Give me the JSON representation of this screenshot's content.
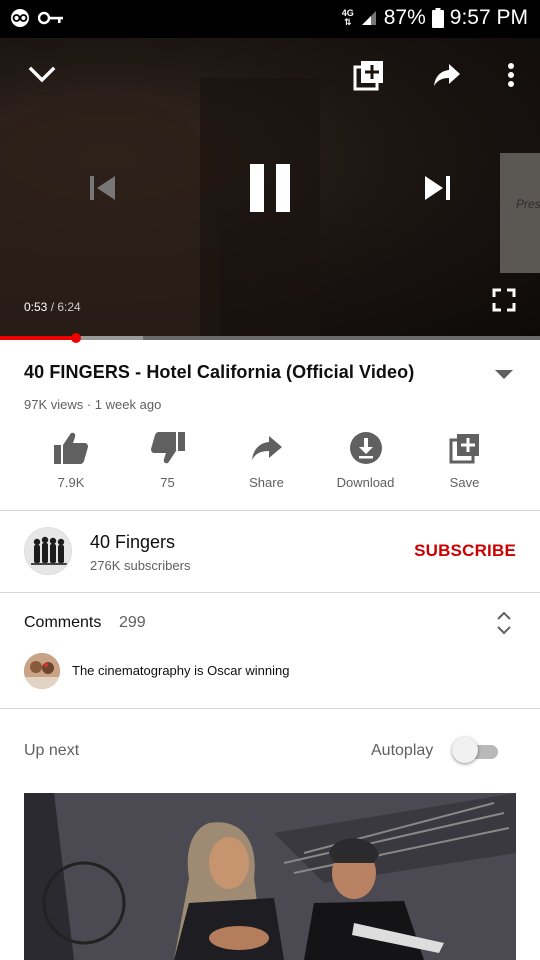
{
  "status_bar": {
    "network": "4G",
    "battery": "87%",
    "time": "9:57 PM"
  },
  "player": {
    "current_time": "0:53",
    "separator": " / ",
    "duration": "6:24",
    "progress_fraction": 0.14,
    "buffer_fraction": 0.265,
    "sign_text": "Pres"
  },
  "video": {
    "title": "40 FINGERS - Hotel California (Official Video)",
    "meta": "97K views · 1 week ago"
  },
  "actions": [
    {
      "label": "7.9K",
      "icon": "thumbs-up-icon"
    },
    {
      "label": "75",
      "icon": "thumbs-down-icon"
    },
    {
      "label": "Share",
      "icon": "share-icon"
    },
    {
      "label": "Download",
      "icon": "download-icon"
    },
    {
      "label": "Save",
      "icon": "add-to-playlist-icon"
    }
  ],
  "channel": {
    "name": "40 Fingers",
    "subscribers": "276K subscribers",
    "subscribe_label": "SUBSCRIBE"
  },
  "comments": {
    "title": "Comments",
    "count": "299",
    "top_comment": "The cinematography is Oscar winning"
  },
  "up_next": {
    "title": "Up next",
    "autoplay_label": "Autoplay",
    "autoplay_on": false
  },
  "colors": {
    "accent_red": "#cc0000",
    "progress_red": "#ee0000",
    "secondary_text": "#606060"
  }
}
